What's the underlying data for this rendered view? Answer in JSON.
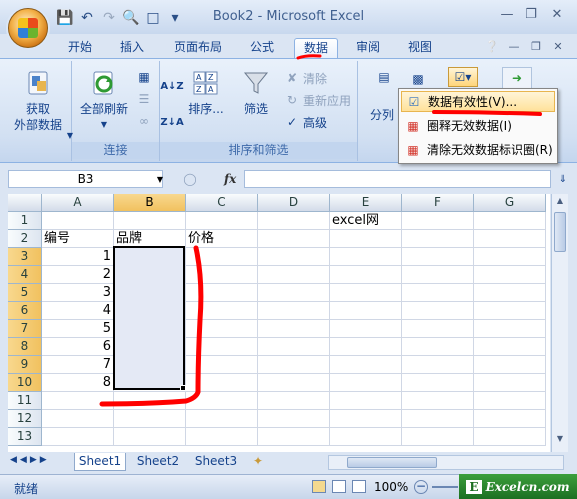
{
  "window": {
    "title": "Book2 - Microsoft Excel"
  },
  "tabs": [
    "开始",
    "插入",
    "页面布局",
    "公式",
    "数据",
    "审阅",
    "视图"
  ],
  "active_tab": "数据",
  "ribbon": {
    "get_external": {
      "line1": "获取",
      "line2": "外部数据"
    },
    "refresh_all": "全部刷新",
    "connections_group": "连接",
    "sort": "排序...",
    "filter": "筛选",
    "clear": "清除",
    "reapply": "重新应用",
    "advanced": "高级",
    "sort_filter_group": "排序和筛选",
    "split": "分列"
  },
  "menu": {
    "items": [
      "数据有效性(V)...",
      "圈释无效数据(I)",
      "清除无效数据标识圈(R)"
    ]
  },
  "formula_bar": {
    "name_box": "B3",
    "fx": "fx",
    "value": ""
  },
  "sheet": {
    "columns": [
      "A",
      "B",
      "C",
      "D",
      "E",
      "F",
      "G"
    ],
    "rows": [
      "1",
      "2",
      "3",
      "4",
      "5",
      "6",
      "7",
      "8",
      "9",
      "10",
      "11",
      "12",
      "13"
    ],
    "cells": {
      "E1": "excel网",
      "A2": "编号",
      "B2": "品牌",
      "C2": "价格",
      "A3": "1",
      "A4": "2",
      "A5": "3",
      "A6": "4",
      "A7": "5",
      "A8": "6",
      "A9": "7",
      "A10": "8"
    }
  },
  "sheet_tabs": [
    "Sheet1",
    "Sheet2",
    "Sheet3"
  ],
  "status": {
    "ready": "就绪",
    "zoom": "100%"
  },
  "watermark": "Excelcn.com",
  "colors": {
    "annotation": "#ff0000",
    "accent": "#15428b"
  }
}
